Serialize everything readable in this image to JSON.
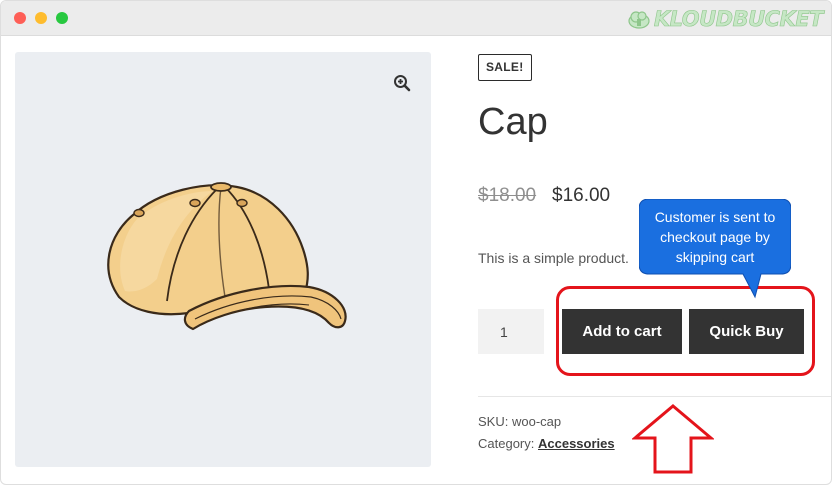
{
  "watermark": {
    "text": "KLOUDBUCKET"
  },
  "product": {
    "sale_badge": "SALE!",
    "title": "Cap",
    "price_old": "$18.00",
    "price_new": "$16.00",
    "description": "This is a simple product.",
    "quantity": "1",
    "add_to_cart_label": "Add to cart",
    "quick_buy_label": "Quick Buy",
    "sku_label": "SKU:",
    "sku_value": "woo-cap",
    "category_label": "Category:",
    "category_value": "Accessories"
  },
  "annotation": {
    "callout_text": "Customer is sent to checkout page by skipping cart"
  },
  "icons": {
    "zoom": "zoom-in-icon",
    "cloud": "cloud-icon"
  },
  "colors": {
    "button_bg": "#333333",
    "highlight_red": "#e4141b",
    "callout_blue": "#1a6fe0",
    "image_bg": "#ebeef2"
  }
}
